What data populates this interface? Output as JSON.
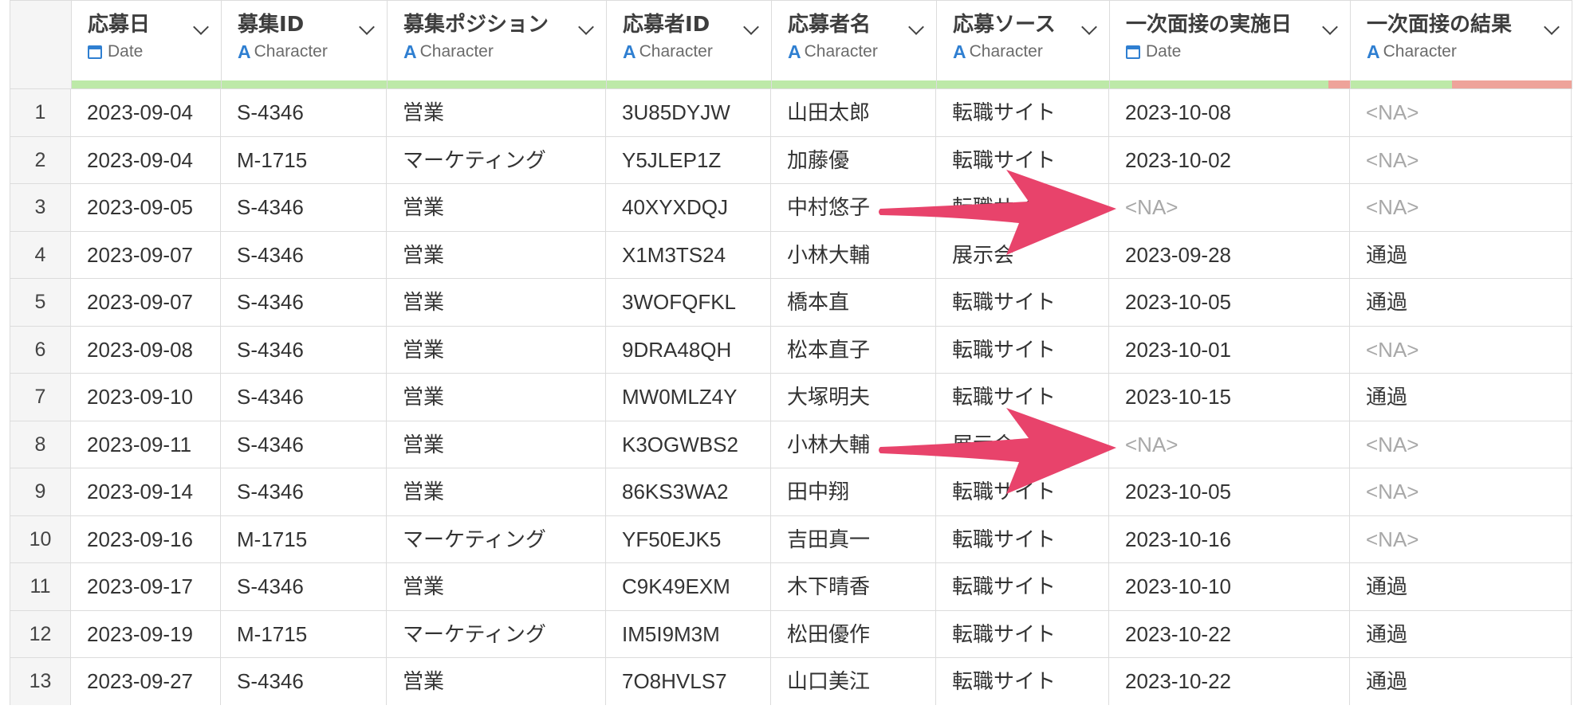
{
  "columns": [
    {
      "name": "応募日",
      "type": "Date",
      "type_icon": "calendar-icon"
    },
    {
      "name": "募集ID",
      "type": "Character",
      "type_icon": "character-type-icon"
    },
    {
      "name": "募集ポジション",
      "type": "Character",
      "type_icon": "character-type-icon"
    },
    {
      "name": "応募者ID",
      "type": "Character",
      "type_icon": "character-type-icon"
    },
    {
      "name": "応募者名",
      "type": "Character",
      "type_icon": "character-type-icon"
    },
    {
      "name": "応募ソース",
      "type": "Character",
      "type_icon": "character-type-icon"
    },
    {
      "name": "一次面接の実施日",
      "type": "Date",
      "type_icon": "calendar-icon"
    },
    {
      "name": "一次面接の結果",
      "type": "Character",
      "type_icon": "character-type-icon"
    }
  ],
  "na_label": "<NA>",
  "rows": [
    {
      "n": "1",
      "cells": [
        "2023-09-04",
        "S-4346",
        "営業",
        "3U85DYJW",
        "山田太郎",
        "転職サイト",
        "2023-10-08",
        "<NA>"
      ]
    },
    {
      "n": "2",
      "cells": [
        "2023-09-04",
        "M-1715",
        "マーケティング",
        "Y5JLEP1Z",
        "加藤優",
        "転職サイト",
        "2023-10-02",
        "<NA>"
      ]
    },
    {
      "n": "3",
      "cells": [
        "2023-09-05",
        "S-4346",
        "営業",
        "40XYXDQJ",
        "中村悠子",
        "転職サイト",
        "<NA>",
        "<NA>"
      ]
    },
    {
      "n": "4",
      "cells": [
        "2023-09-07",
        "S-4346",
        "営業",
        "X1M3TS24",
        "小林大輔",
        "展示会",
        "2023-09-28",
        "通過"
      ]
    },
    {
      "n": "5",
      "cells": [
        "2023-09-07",
        "S-4346",
        "営業",
        "3WOFQFKL",
        "橋本直",
        "転職サイト",
        "2023-10-05",
        "通過"
      ]
    },
    {
      "n": "6",
      "cells": [
        "2023-09-08",
        "S-4346",
        "営業",
        "9DRA48QH",
        "松本直子",
        "転職サイト",
        "2023-10-01",
        "<NA>"
      ]
    },
    {
      "n": "7",
      "cells": [
        "2023-09-10",
        "S-4346",
        "営業",
        "MW0MLZ4Y",
        "大塚明夫",
        "転職サイト",
        "2023-10-15",
        "通過"
      ]
    },
    {
      "n": "8",
      "cells": [
        "2023-09-11",
        "S-4346",
        "営業",
        "K3OGWBS2",
        "小林大輔",
        "展示会",
        "<NA>",
        "<NA>"
      ]
    },
    {
      "n": "9",
      "cells": [
        "2023-09-14",
        "S-4346",
        "営業",
        "86KS3WA2",
        "田中翔",
        "転職サイト",
        "2023-10-05",
        "<NA>"
      ]
    },
    {
      "n": "10",
      "cells": [
        "2023-09-16",
        "M-1715",
        "マーケティング",
        "YF50EJK5",
        "吉田真一",
        "転職サイト",
        "2023-10-16",
        "<NA>"
      ]
    },
    {
      "n": "11",
      "cells": [
        "2023-09-17",
        "S-4346",
        "営業",
        "C9K49EXM",
        "木下晴香",
        "転職サイト",
        "2023-10-10",
        "通過"
      ]
    },
    {
      "n": "12",
      "cells": [
        "2023-09-19",
        "M-1715",
        "マーケティング",
        "IM5I9M3M",
        "松田優作",
        "転職サイト",
        "2023-10-22",
        "通過"
      ]
    },
    {
      "n": "13",
      "cells": [
        "2023-09-27",
        "S-4346",
        "営業",
        "7O8HVLS7",
        "山口美江",
        "転職サイト",
        "2023-10-22",
        "通過"
      ]
    }
  ],
  "quality": {
    "na_ratio_by_column": [
      0,
      0,
      0,
      0,
      0,
      0,
      0.09,
      0.54
    ]
  },
  "colors": {
    "valid_bar": "#bde9a8",
    "missing_bar": "#eea39a",
    "type_icon": "#2f7fd1",
    "na_text": "#a8a8a8",
    "arrow": "#e8436b"
  }
}
